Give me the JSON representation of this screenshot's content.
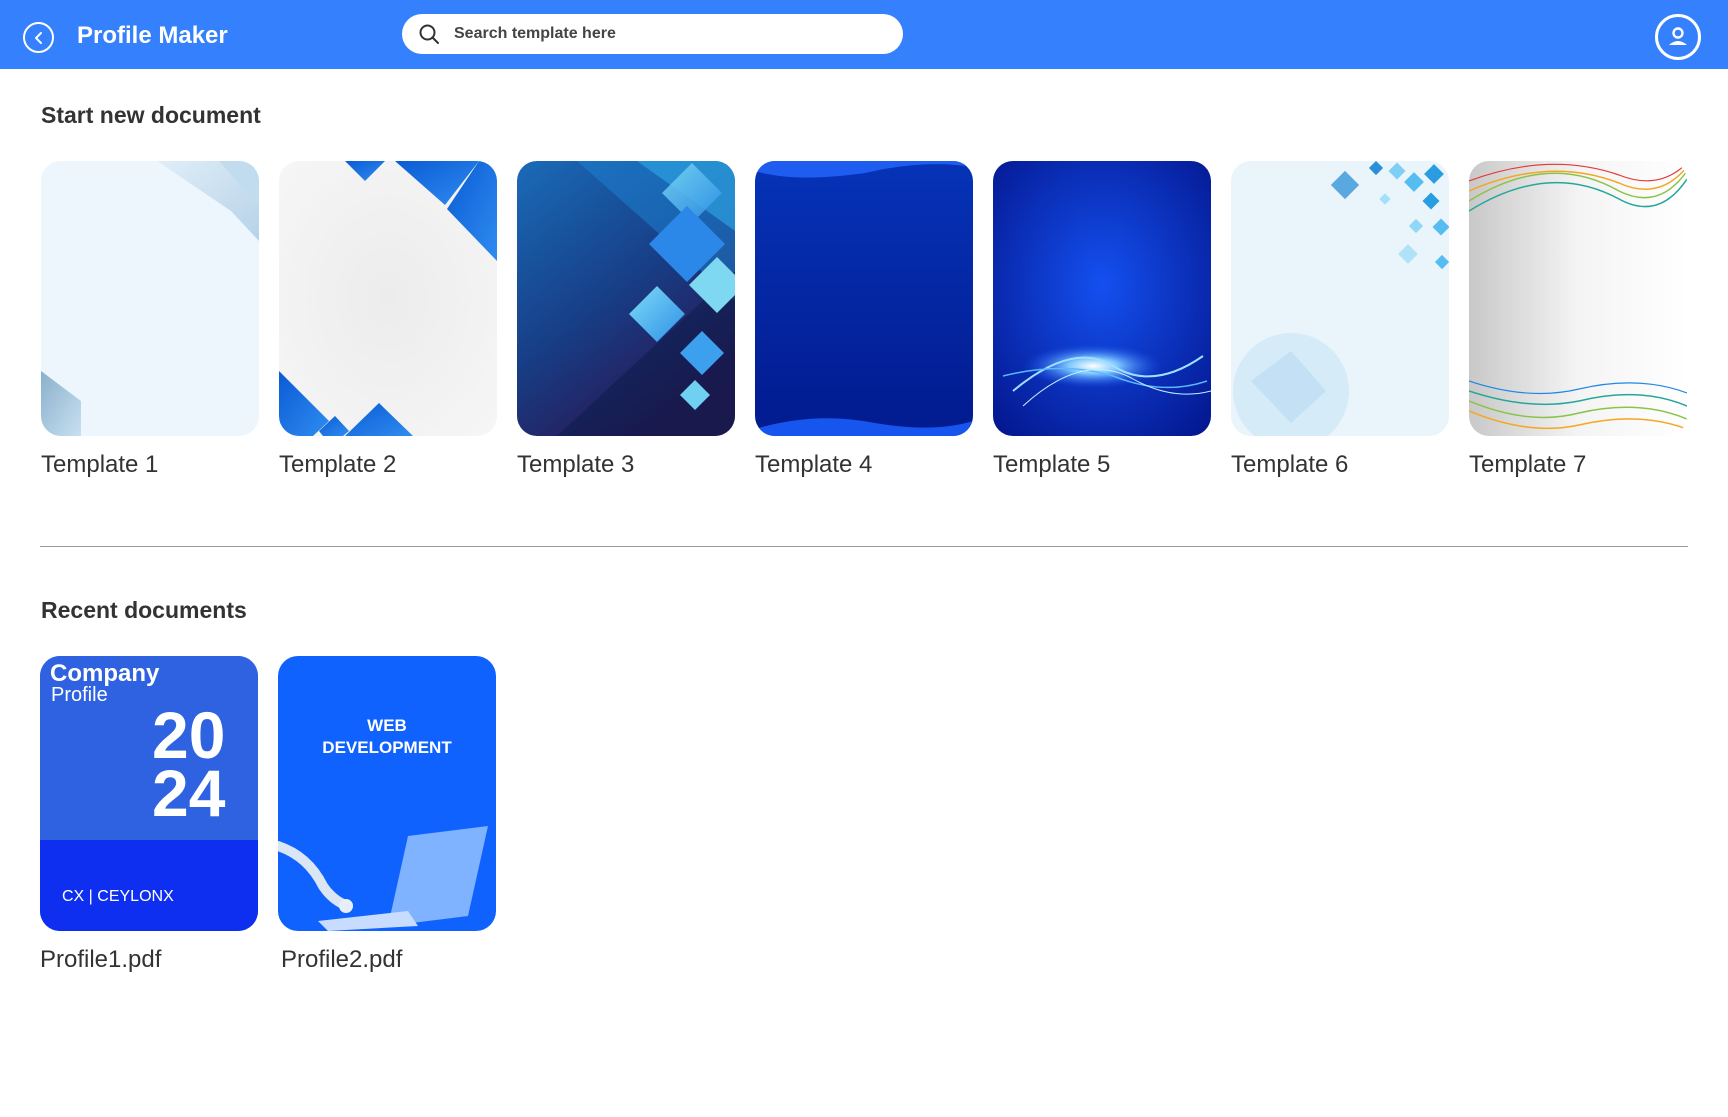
{
  "app": {
    "title": "Profile Maker"
  },
  "header": {
    "back_icon": "chevron-left-icon",
    "search_icon": "search-icon",
    "search_placeholder": "Search template here",
    "account_icon": "user-icon",
    "brand_color": "#3580fc"
  },
  "templates": {
    "section_title": "Start new document",
    "items": [
      {
        "label": "Template 1"
      },
      {
        "label": "Template 2"
      },
      {
        "label": "Template 3"
      },
      {
        "label": "Template 4"
      },
      {
        "label": "Template 5"
      },
      {
        "label": "Template 6"
      },
      {
        "label": "Template 7"
      }
    ]
  },
  "recent": {
    "section_title": "Recent documents",
    "items": [
      {
        "label": "Profile1.pdf",
        "cover": {
          "line1": "Company",
          "line2": "Profile",
          "year_top": "20",
          "year_bottom": "24",
          "brand": "CX | CEYLONX"
        }
      },
      {
        "label": "Profile2.pdf",
        "cover": {
          "line1": "WEB",
          "line2": "DEVELOPMENT"
        }
      }
    ]
  }
}
